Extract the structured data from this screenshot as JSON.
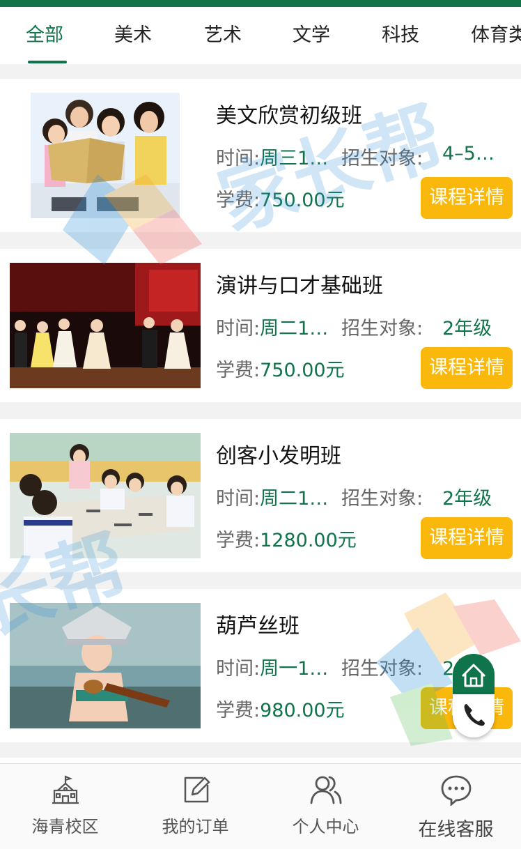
{
  "tabs": [
    "全部",
    "美术",
    "艺术",
    "文学",
    "科技",
    "体育类"
  ],
  "active_tab": 0,
  "courses": [
    {
      "title": "美文欣赏初级班",
      "time_label": "时间:",
      "time_value": "周三1",
      "ellipsis": "…",
      "target_label": "招生对象:",
      "target_value": "4–5…",
      "fee_label": "学费:",
      "fee_value": "750.00元",
      "button": "课程详情"
    },
    {
      "title": "演讲与口才基础班",
      "time_label": "时间:",
      "time_value": "周二1",
      "ellipsis": "…",
      "target_label": "招生对象:",
      "target_value": "2年级",
      "fee_label": "学费:",
      "fee_value": "750.00元",
      "button": "课程详情"
    },
    {
      "title": "创客小发明班",
      "time_label": "时间:",
      "time_value": "周二1",
      "ellipsis": "…",
      "target_label": "招生对象:",
      "target_value": "2年级",
      "fee_label": "学费:",
      "fee_value": "1280.00元",
      "button": "课程详情"
    },
    {
      "title": "葫芦丝班",
      "time_label": "时间:",
      "time_value": "周一1",
      "ellipsis": "…",
      "target_label": "招生对象:",
      "target_value": "2年级",
      "fee_label": "学费:",
      "fee_value": "980.00元",
      "button": "课程详情"
    }
  ],
  "watermark": {
    "text1": "家长帮",
    "text2": "长帮"
  },
  "bottom_nav": [
    {
      "label": "海青校区",
      "icon": "school-icon"
    },
    {
      "label": "我的订单",
      "icon": "edit-icon"
    },
    {
      "label": "个人中心",
      "icon": "users-icon"
    },
    {
      "label": "在线客服",
      "icon": "chat-icon"
    }
  ],
  "float_buttons": {
    "home_icon": "home-icon",
    "phone_icon": "phone-icon"
  },
  "colors": {
    "brand": "#10744a",
    "button": "#f9b80b"
  }
}
